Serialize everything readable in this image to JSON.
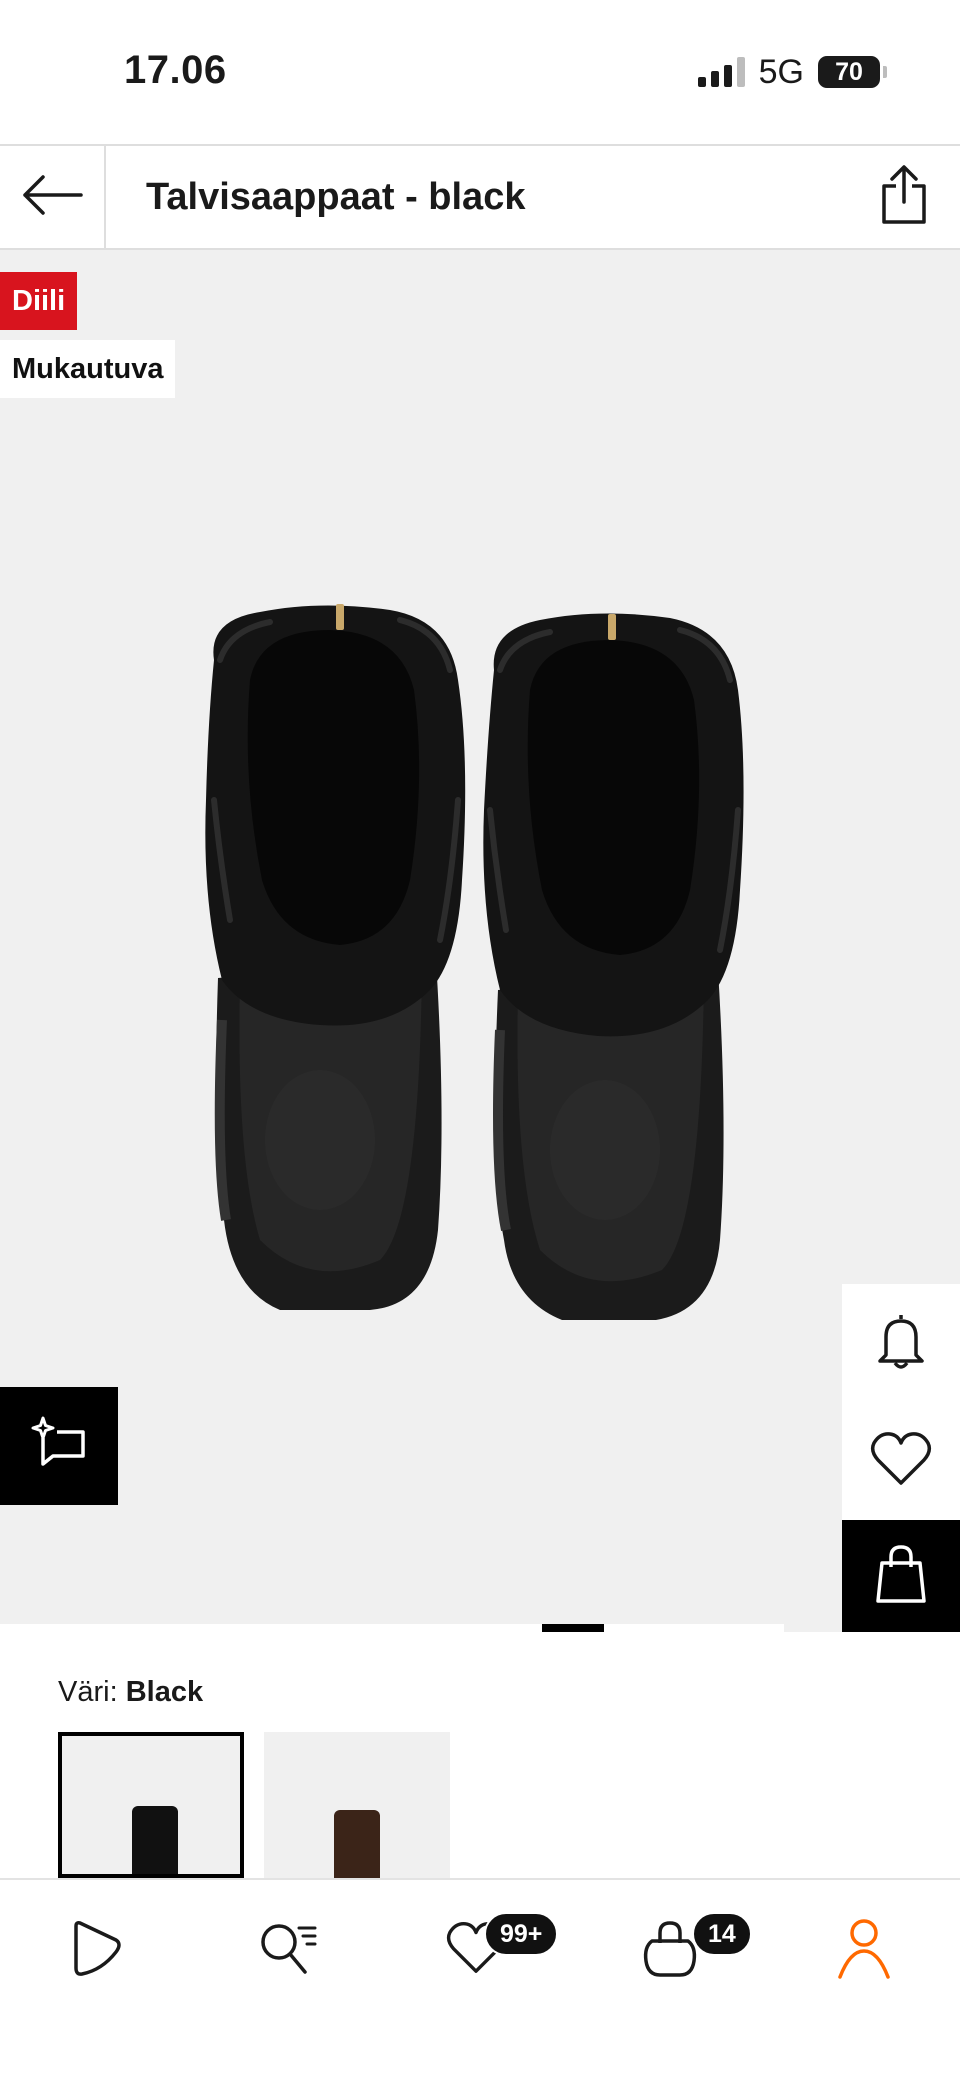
{
  "status_bar": {
    "time": "17.06",
    "network": "5G",
    "battery": "70"
  },
  "header": {
    "title": "Talvisaappaat - black"
  },
  "product": {
    "badges": {
      "deal": "Diili",
      "fit": "Mukautuva"
    },
    "colors": {
      "accent_red": "#d8141e",
      "nav_active": "#ff6900"
    }
  },
  "pager": {
    "current_page": 2,
    "total_pages": 3
  },
  "color_select": {
    "label": "Väri:",
    "selected": "Black",
    "options": [
      "black",
      "brown"
    ]
  },
  "bottom_nav": {
    "items": [
      "home-icon",
      "search-icon",
      "wishlist-icon",
      "bag-icon",
      "profile-icon"
    ],
    "wishlist_count": "99+",
    "bag_count": "14"
  }
}
